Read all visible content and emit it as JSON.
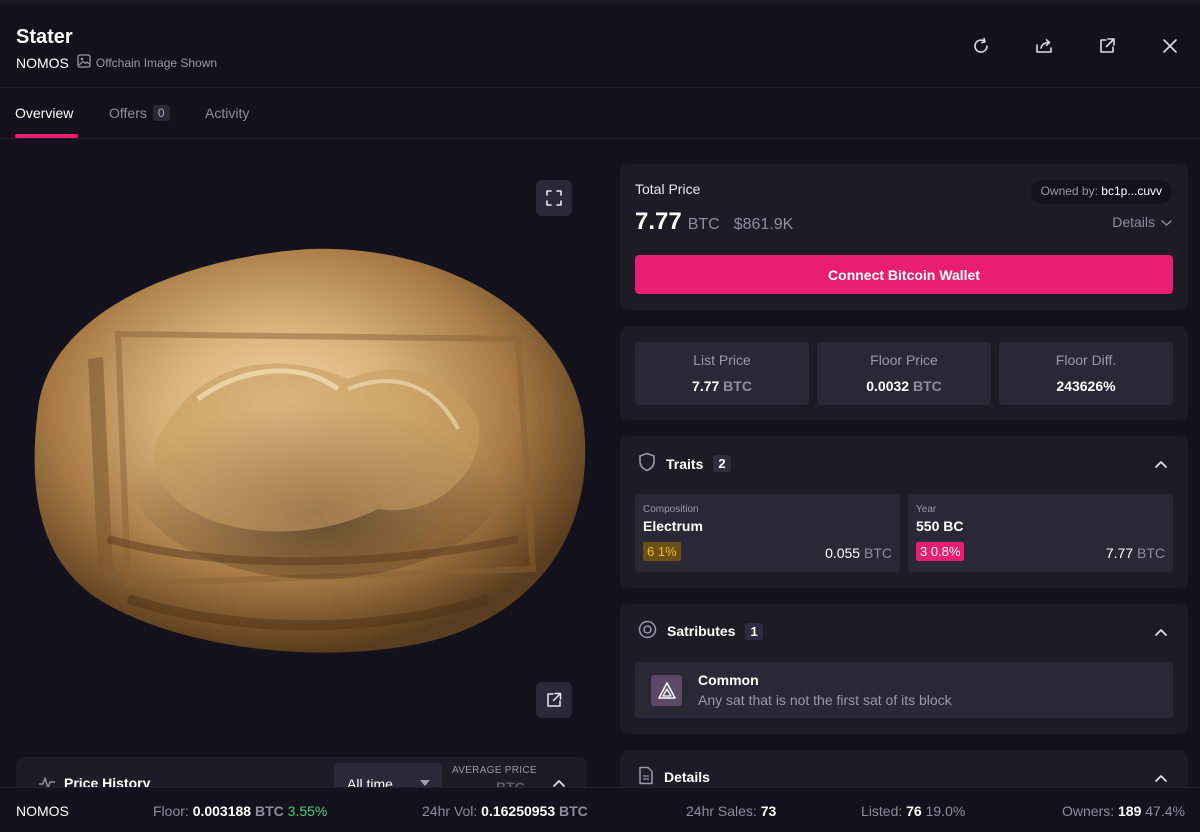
{
  "header": {
    "title": "Stater",
    "collection": "NOMOS",
    "offchain_label": "Offchain Image Shown",
    "icons": [
      "refresh-icon",
      "share-icon",
      "external-link-icon",
      "close-icon"
    ]
  },
  "tabs": [
    {
      "label": "Overview",
      "active": true
    },
    {
      "label": "Offers",
      "count": "0"
    },
    {
      "label": "Activity"
    }
  ],
  "media": {
    "image_subject": "gold electrum stater coin",
    "buttons": [
      "fullscreen-icon",
      "open-external-icon"
    ]
  },
  "price_history": {
    "title": "Price History",
    "range_select": "All time",
    "avg_label": "AVERAGE PRICE",
    "avg_value": "BTC"
  },
  "price_card": {
    "label": "Total Price",
    "owned_label": "Owned by:",
    "owner": "bc1p...cuvv",
    "price": "7.77",
    "unit": "BTC",
    "usd": "$861.9K",
    "details_label": "Details",
    "connect_label": "Connect Bitcoin Wallet",
    "accent": "#e91e70"
  },
  "stats": [
    {
      "label": "List Price",
      "value": "7.77",
      "unit": "BTC"
    },
    {
      "label": "Floor Price",
      "value": "0.0032",
      "unit": "BTC"
    },
    {
      "label": "Floor Diff.",
      "value": "243626%",
      "unit": ""
    }
  ],
  "traits": {
    "title": "Traits",
    "count": "2",
    "items": [
      {
        "type": "Composition",
        "value": "Electrum",
        "pct": "6 1%",
        "price": "0.055",
        "unit": "BTC",
        "badge_color": "#6b4f14",
        "badge_text_color": "#f0b93a"
      },
      {
        "type": "Year",
        "value": "550 BC",
        "pct": "3 0.8%",
        "price": "7.77",
        "unit": "BTC",
        "badge_color": "#e91e70",
        "badge_text_color": "#ffffff"
      }
    ]
  },
  "satributes": {
    "title": "Satributes",
    "count": "1",
    "items": [
      {
        "name": "Common",
        "description": "Any sat that is not the first sat of its block"
      }
    ]
  },
  "details_section": {
    "title": "Details"
  },
  "footer": {
    "collection": "NOMOS",
    "floor_label": "Floor:",
    "floor_value": "0.003188",
    "floor_unit": "BTC",
    "floor_change": "3.55%",
    "vol_label": "24hr Vol:",
    "vol_value": "0.16250953",
    "vol_unit": "BTC",
    "sales_label": "24hr Sales:",
    "sales_value": "73",
    "listed_label": "Listed:",
    "listed_value": "76",
    "listed_pct": "19.0%",
    "owners_label": "Owners:",
    "owners_value": "189",
    "owners_pct": "47.4%"
  }
}
